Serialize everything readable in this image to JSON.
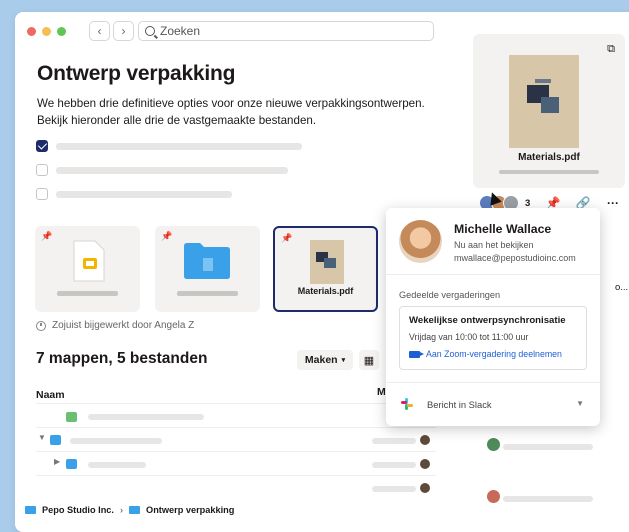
{
  "search": {
    "placeholder": "Zoeken"
  },
  "page": {
    "title": "Ontwerp verpakking",
    "description": "We hebben drie definitieve opties voor onze nieuwe verpakkingsontwerpen. Bekijk hieronder alle drie de vastgemaakte bestanden."
  },
  "tasks": [
    {
      "checked": true
    },
    {
      "checked": false
    },
    {
      "checked": false
    }
  ],
  "pinned_files": [
    {
      "type": "slides",
      "label": ""
    },
    {
      "type": "folder",
      "label": ""
    },
    {
      "type": "document",
      "label": "Materials.pdf",
      "selected": true
    }
  ],
  "updated_text": "Zojuist bijgewerkt door Angela Z",
  "summary": "7 mappen, 5 bestanden",
  "toolbar": {
    "create_label": "Maken",
    "view_icon": "grid-icon"
  },
  "table": {
    "col_name": "Naam",
    "col_modified": "M"
  },
  "preview": {
    "file_name": "Materials.pdf",
    "open_icon": "external-link-icon"
  },
  "viewers": {
    "count": "3"
  },
  "actions": {
    "pin_icon": "pin-icon",
    "link_icon": "link-icon",
    "more_label": "···"
  },
  "popup": {
    "name": "Michelle Wallace",
    "status": "Nu aan het bekijken",
    "email": "mwallace@pepostudioinc.com",
    "shared_label": "Gedeelde vergaderingen",
    "meeting_title": "Wekelijkse ontwerpsynchronisatie",
    "meeting_time": "Vrijdag van 10:00 tot 11:00 uur",
    "meeting_link": "Aan Zoom-vergadering deelnemen",
    "slack_label": "Bericht in Slack"
  },
  "overflow_text": "o...",
  "breadcrumb": {
    "root": "Pepo Studio Inc.",
    "separator": "›",
    "current": "Ontwerp verpakking"
  },
  "colors": {
    "accent": "#1f2a6b",
    "folder": "#3aa0e8",
    "link": "#1e60d4",
    "background": "#a9ccea"
  }
}
